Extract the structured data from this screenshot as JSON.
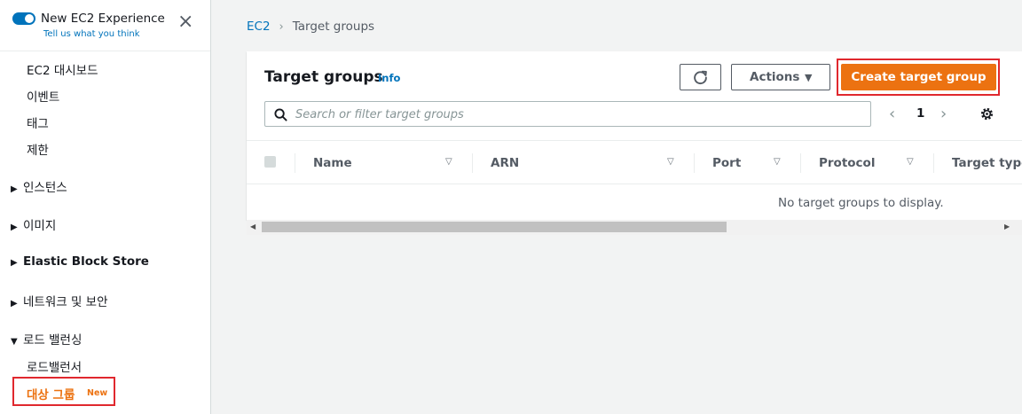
{
  "sidebar": {
    "experience_title": "New EC2 Experience",
    "experience_link": "Tell us what you think",
    "close_icon": "×",
    "items": [
      {
        "label": "EC2 대시보드"
      },
      {
        "label": "이벤트"
      },
      {
        "label": "태그"
      },
      {
        "label": "제한"
      }
    ],
    "sections": [
      {
        "label": "인스턴스",
        "expanded": false
      },
      {
        "label": "이미지",
        "expanded": false
      },
      {
        "label": "Elastic Block Store",
        "expanded": false
      },
      {
        "label": "네트워크 및 보안",
        "expanded": false
      },
      {
        "label": "로드 밸런싱",
        "expanded": true
      }
    ],
    "lb_items": [
      {
        "label": "로드밸런서"
      }
    ],
    "active_item": {
      "label": "대상 그룹",
      "badge": "New"
    },
    "collapsed_glyph": "▶",
    "expanded_glyph": "▼"
  },
  "breadcrumb": {
    "root": "EC2",
    "separator": "›",
    "current": "Target groups"
  },
  "panel": {
    "title": "Target groups",
    "info": "Info",
    "actions_label": "Actions",
    "actions_caret": "▼",
    "create_label": "Create target group",
    "search_placeholder": "Search or filter target groups",
    "pager": {
      "prev": "‹",
      "page": "1",
      "next": "›"
    },
    "columns": [
      {
        "label": "Name"
      },
      {
        "label": "ARN"
      },
      {
        "label": "Port"
      },
      {
        "label": "Protocol"
      },
      {
        "label": "Target type"
      }
    ],
    "sort_glyph": "▽",
    "empty_message": "No target groups to display."
  },
  "scrollbar": {
    "left_arrow": "◀",
    "right_arrow": "▶"
  },
  "colors": {
    "accent": "#0073bb",
    "primary_button": "#ec7211",
    "highlight_border": "#e0282e",
    "active_nav": "#ec7211"
  }
}
